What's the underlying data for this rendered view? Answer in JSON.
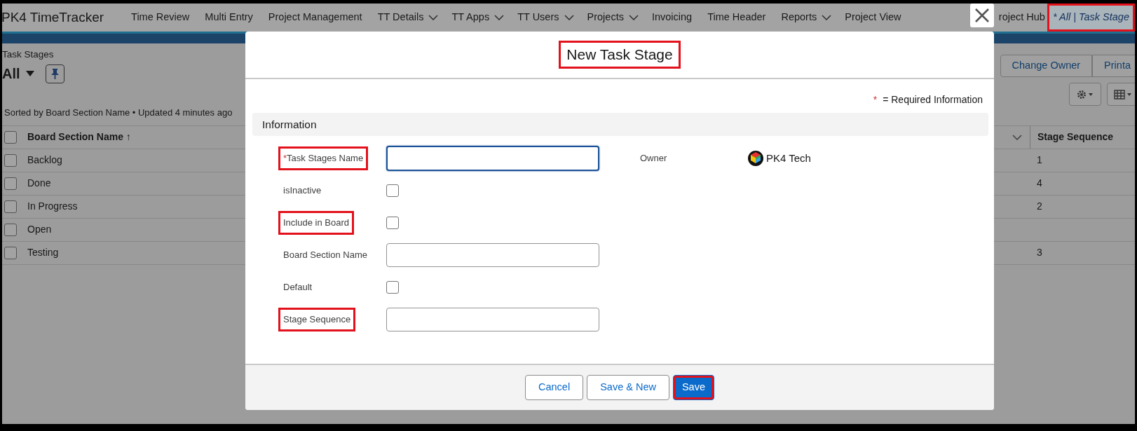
{
  "app": {
    "title": "PK4 TimeTracker"
  },
  "nav_tabs": [
    {
      "label": "Time Review",
      "dropdown": false,
      "selected": false
    },
    {
      "label": "Multi Entry",
      "dropdown": false,
      "selected": false
    },
    {
      "label": "Project Management",
      "dropdown": false,
      "selected": false
    },
    {
      "label": "TT Details",
      "dropdown": true,
      "selected": false
    },
    {
      "label": "TT Apps",
      "dropdown": true,
      "selected": false
    },
    {
      "label": "TT Users",
      "dropdown": true,
      "selected": false
    },
    {
      "label": "Projects",
      "dropdown": true,
      "selected": false
    },
    {
      "label": "Invoicing",
      "dropdown": false,
      "selected": false
    },
    {
      "label": "Time Header",
      "dropdown": false,
      "selected": false
    },
    {
      "label": "Reports",
      "dropdown": true,
      "selected": false
    },
    {
      "label": "Project View",
      "dropdown": false,
      "selected": false
    },
    {
      "label": "roject Hub",
      "dropdown": false,
      "selected": false
    },
    {
      "label": "* All | Task Stage",
      "dropdown": false,
      "selected": true,
      "highlighted": true
    }
  ],
  "list_view": {
    "object": "Task Stages",
    "view": "All",
    "sorted_info": "Sorted by Board Section Name • Updated 4 minutes ago",
    "actions": [
      "Change Owner",
      "Printa"
    ]
  },
  "table": {
    "all_checked": false,
    "columns": [
      {
        "label": "Board Section Name ↑"
      },
      {
        "label": "Stage Sequence"
      }
    ],
    "rows": [
      {
        "board_section_name": "Backlog",
        "stage_sequence": "1",
        "checked": false
      },
      {
        "board_section_name": "Done",
        "stage_sequence": "4",
        "checked": false
      },
      {
        "board_section_name": "In Progress",
        "stage_sequence": "2",
        "checked": false
      },
      {
        "board_section_name": "Open",
        "checked": false
      },
      {
        "board_section_name": "Testing",
        "stage_sequence": "3",
        "checked": false
      }
    ]
  },
  "modal": {
    "title": "New Task Stage",
    "title_highlighted": true,
    "required_note": {
      "marker": "*",
      "text": "= Required Information"
    },
    "section": "Information",
    "fields": [
      {
        "kind": "text",
        "label": "Task Stages Name",
        "required_mark": "*",
        "focused": true,
        "highlighted": true
      },
      {
        "kind": "checkbox",
        "label": "isInactive",
        "checked": false,
        "highlighted": false
      },
      {
        "kind": "checkbox",
        "label": "Include in Board",
        "checked": false,
        "highlighted": true
      },
      {
        "kind": "text",
        "label": "Board Section Name",
        "focused": false,
        "highlighted": false
      },
      {
        "kind": "checkbox",
        "label": "Default",
        "checked": false,
        "highlighted": false
      },
      {
        "kind": "text",
        "label": "Stage Sequence",
        "focused": false,
        "highlighted": true
      }
    ],
    "owner": {
      "label": "Owner",
      "value": "PK4 Tech"
    },
    "buttons": [
      {
        "label": "Cancel",
        "kind": "neutral",
        "highlighted": false
      },
      {
        "label": "Save & New",
        "kind": "neutral",
        "highlighted": false
      },
      {
        "label": "Save",
        "kind": "brand",
        "highlighted": true
      }
    ]
  }
}
